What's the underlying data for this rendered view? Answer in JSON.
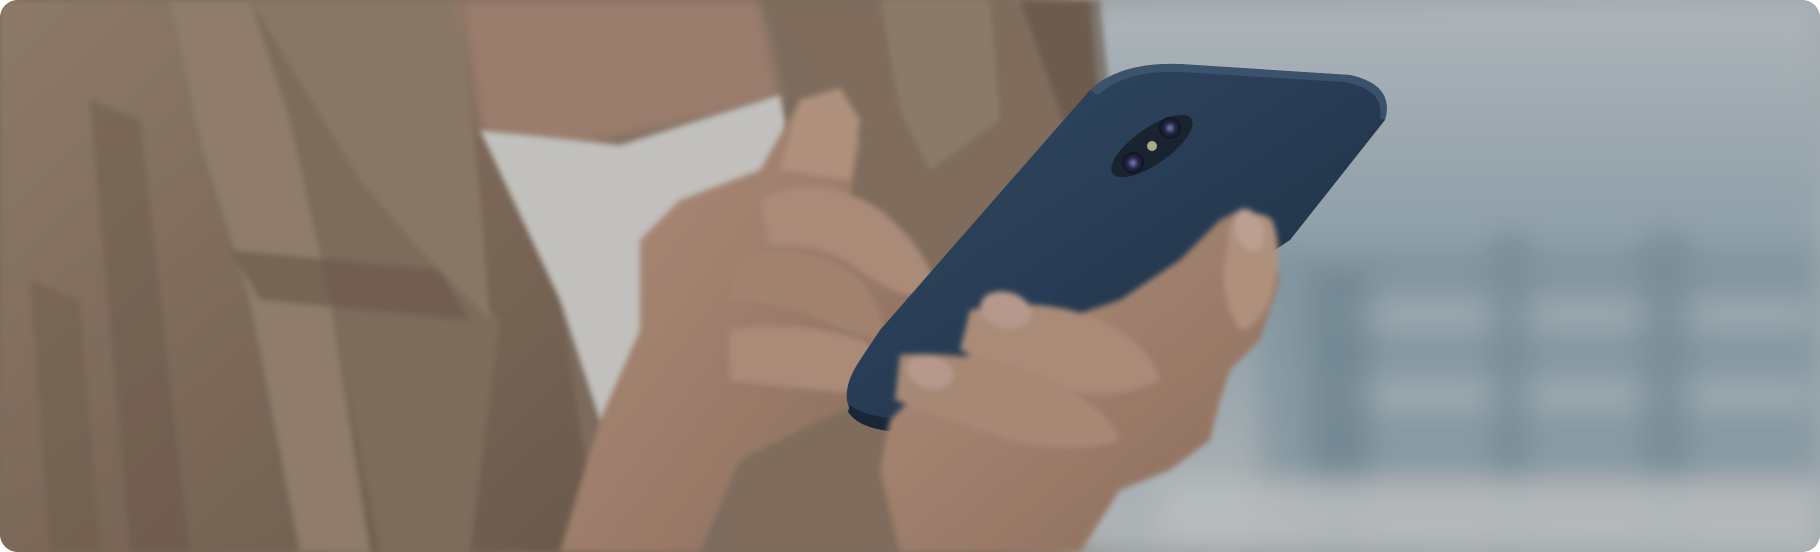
{
  "hero": {
    "image_subject": "woman-holding-smartphone",
    "colors": {
      "jacket": "#9a8470",
      "jacket_shadow": "#6f5d4d",
      "skin": "#b99580",
      "skin_shadow": "#8d6e5d",
      "shirt": "#d9d8d4",
      "phone_case": "#2e4560",
      "phone_case_edge": "#22354b",
      "background_blur": "#a9b6be",
      "background_structure": "#7f97a4",
      "overlay": "#000000"
    },
    "overlay_opacity": 0.12
  }
}
